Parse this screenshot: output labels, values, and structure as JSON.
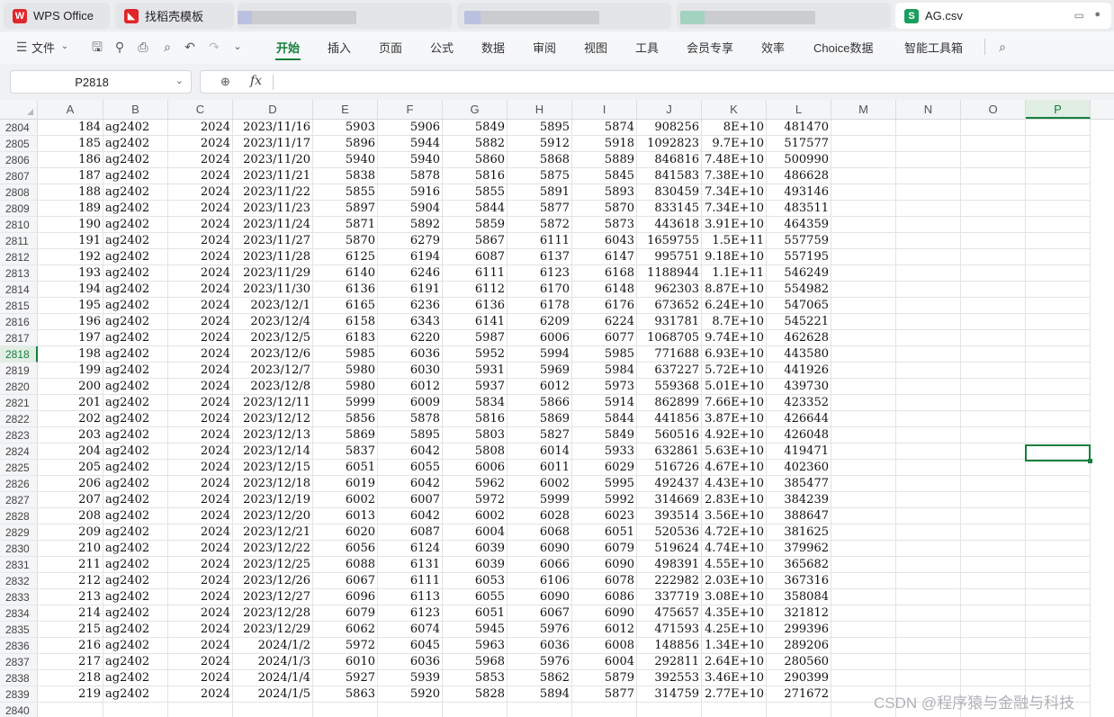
{
  "tabs": [
    {
      "label": "WPS Office",
      "icon": "wps-logo-icon",
      "color": "#e0262b"
    },
    {
      "label": "找稻壳模板",
      "icon": "docer-icon",
      "color": "#e0262b"
    },
    {
      "label": "",
      "icon": "blurred-tab",
      "color": "#9aa3d9"
    },
    {
      "label": "",
      "icon": "blurred-tab",
      "color": "#9aa3d9"
    },
    {
      "label": "",
      "icon": "blurred-tab",
      "color": "#6cc2a0"
    },
    {
      "label": "AG.csv",
      "icon": "spreadsheet-icon",
      "color": "#1a9e5c"
    }
  ],
  "ribbon": {
    "file_label": "文件",
    "tabs": [
      "开始",
      "插入",
      "页面",
      "公式",
      "数据",
      "审阅",
      "视图",
      "工具",
      "会员专享",
      "效率",
      "Choice数据",
      "智能工具箱"
    ],
    "active_tab": "开始"
  },
  "formula_bar": {
    "cell_ref": "P2818",
    "fx_label": "fx",
    "content": ""
  },
  "columns": [
    "A",
    "B",
    "C",
    "D",
    "E",
    "F",
    "G",
    "H",
    "I",
    "J",
    "K",
    "L",
    "M",
    "N",
    "O",
    "P"
  ],
  "selected_column": "P",
  "selected_row": "2818",
  "rows": [
    {
      "n": "2804",
      "v": [
        "184",
        "ag2402",
        "2024",
        "2023/11/16",
        "5903",
        "5906",
        "5849",
        "5895",
        "5874",
        "908256",
        "8E+10",
        "481470"
      ]
    },
    {
      "n": "2805",
      "v": [
        "185",
        "ag2402",
        "2024",
        "2023/11/17",
        "5896",
        "5944",
        "5882",
        "5912",
        "5918",
        "1092823",
        "9.7E+10",
        "517577"
      ]
    },
    {
      "n": "2806",
      "v": [
        "186",
        "ag2402",
        "2024",
        "2023/11/20",
        "5940",
        "5940",
        "5860",
        "5868",
        "5889",
        "846816",
        "7.48E+10",
        "500990"
      ]
    },
    {
      "n": "2807",
      "v": [
        "187",
        "ag2402",
        "2024",
        "2023/11/21",
        "5838",
        "5878",
        "5816",
        "5875",
        "5845",
        "841583",
        "7.38E+10",
        "486628"
      ]
    },
    {
      "n": "2808",
      "v": [
        "188",
        "ag2402",
        "2024",
        "2023/11/22",
        "5855",
        "5916",
        "5855",
        "5891",
        "5893",
        "830459",
        "7.34E+10",
        "493146"
      ]
    },
    {
      "n": "2809",
      "v": [
        "189",
        "ag2402",
        "2024",
        "2023/11/23",
        "5897",
        "5904",
        "5844",
        "5877",
        "5870",
        "833145",
        "7.34E+10",
        "483511"
      ]
    },
    {
      "n": "2810",
      "v": [
        "190",
        "ag2402",
        "2024",
        "2023/11/24",
        "5871",
        "5892",
        "5859",
        "5872",
        "5873",
        "443618",
        "3.91E+10",
        "464359"
      ]
    },
    {
      "n": "2811",
      "v": [
        "191",
        "ag2402",
        "2024",
        "2023/11/27",
        "5870",
        "6279",
        "5867",
        "6111",
        "6043",
        "1659755",
        "1.5E+11",
        "557759"
      ]
    },
    {
      "n": "2812",
      "v": [
        "192",
        "ag2402",
        "2024",
        "2023/11/28",
        "6125",
        "6194",
        "6087",
        "6137",
        "6147",
        "995751",
        "9.18E+10",
        "557195"
      ]
    },
    {
      "n": "2813",
      "v": [
        "193",
        "ag2402",
        "2024",
        "2023/11/29",
        "6140",
        "6246",
        "6111",
        "6123",
        "6168",
        "1188944",
        "1.1E+11",
        "546249"
      ]
    },
    {
      "n": "2814",
      "v": [
        "194",
        "ag2402",
        "2024",
        "2023/11/30",
        "6136",
        "6191",
        "6112",
        "6170",
        "6148",
        "962303",
        "8.87E+10",
        "554982"
      ]
    },
    {
      "n": "2815",
      "v": [
        "195",
        "ag2402",
        "2024",
        "2023/12/1",
        "6165",
        "6236",
        "6136",
        "6178",
        "6176",
        "673652",
        "6.24E+10",
        "547065"
      ]
    },
    {
      "n": "2816",
      "v": [
        "196",
        "ag2402",
        "2024",
        "2023/12/4",
        "6158",
        "6343",
        "6141",
        "6209",
        "6224",
        "931781",
        "8.7E+10",
        "545221"
      ]
    },
    {
      "n": "2817",
      "v": [
        "197",
        "ag2402",
        "2024",
        "2023/12/5",
        "6183",
        "6220",
        "5987",
        "6006",
        "6077",
        "1068705",
        "9.74E+10",
        "462628"
      ]
    },
    {
      "n": "2818",
      "v": [
        "198",
        "ag2402",
        "2024",
        "2023/12/6",
        "5985",
        "6036",
        "5952",
        "5994",
        "5985",
        "771688",
        "6.93E+10",
        "443580"
      ]
    },
    {
      "n": "2819",
      "v": [
        "199",
        "ag2402",
        "2024",
        "2023/12/7",
        "5980",
        "6030",
        "5931",
        "5969",
        "5984",
        "637227",
        "5.72E+10",
        "441926"
      ]
    },
    {
      "n": "2820",
      "v": [
        "200",
        "ag2402",
        "2024",
        "2023/12/8",
        "5980",
        "6012",
        "5937",
        "6012",
        "5973",
        "559368",
        "5.01E+10",
        "439730"
      ]
    },
    {
      "n": "2821",
      "v": [
        "201",
        "ag2402",
        "2024",
        "2023/12/11",
        "5999",
        "6009",
        "5834",
        "5866",
        "5914",
        "862899",
        "7.66E+10",
        "423352"
      ]
    },
    {
      "n": "2822",
      "v": [
        "202",
        "ag2402",
        "2024",
        "2023/12/12",
        "5856",
        "5878",
        "5816",
        "5869",
        "5844",
        "441856",
        "3.87E+10",
        "426644"
      ]
    },
    {
      "n": "2823",
      "v": [
        "203",
        "ag2402",
        "2024",
        "2023/12/13",
        "5869",
        "5895",
        "5803",
        "5827",
        "5849",
        "560516",
        "4.92E+10",
        "426048"
      ]
    },
    {
      "n": "2824",
      "v": [
        "204",
        "ag2402",
        "2024",
        "2023/12/14",
        "5837",
        "6042",
        "5808",
        "6014",
        "5933",
        "632861",
        "5.63E+10",
        "419471"
      ]
    },
    {
      "n": "2825",
      "v": [
        "205",
        "ag2402",
        "2024",
        "2023/12/15",
        "6051",
        "6055",
        "6006",
        "6011",
        "6029",
        "516726",
        "4.67E+10",
        "402360"
      ]
    },
    {
      "n": "2826",
      "v": [
        "206",
        "ag2402",
        "2024",
        "2023/12/18",
        "6019",
        "6042",
        "5962",
        "6002",
        "5995",
        "492437",
        "4.43E+10",
        "385477"
      ]
    },
    {
      "n": "2827",
      "v": [
        "207",
        "ag2402",
        "2024",
        "2023/12/19",
        "6002",
        "6007",
        "5972",
        "5999",
        "5992",
        "314669",
        "2.83E+10",
        "384239"
      ]
    },
    {
      "n": "2828",
      "v": [
        "208",
        "ag2402",
        "2024",
        "2023/12/20",
        "6013",
        "6042",
        "6002",
        "6028",
        "6023",
        "393514",
        "3.56E+10",
        "388647"
      ]
    },
    {
      "n": "2829",
      "v": [
        "209",
        "ag2402",
        "2024",
        "2023/12/21",
        "6020",
        "6087",
        "6004",
        "6068",
        "6051",
        "520536",
        "4.72E+10",
        "381625"
      ]
    },
    {
      "n": "2830",
      "v": [
        "210",
        "ag2402",
        "2024",
        "2023/12/22",
        "6056",
        "6124",
        "6039",
        "6090",
        "6079",
        "519624",
        "4.74E+10",
        "379962"
      ]
    },
    {
      "n": "2831",
      "v": [
        "211",
        "ag2402",
        "2024",
        "2023/12/25",
        "6088",
        "6131",
        "6039",
        "6066",
        "6090",
        "498391",
        "4.55E+10",
        "365682"
      ]
    },
    {
      "n": "2832",
      "v": [
        "212",
        "ag2402",
        "2024",
        "2023/12/26",
        "6067",
        "6111",
        "6053",
        "6106",
        "6078",
        "222982",
        "2.03E+10",
        "367316"
      ]
    },
    {
      "n": "2833",
      "v": [
        "213",
        "ag2402",
        "2024",
        "2023/12/27",
        "6096",
        "6113",
        "6055",
        "6090",
        "6086",
        "337719",
        "3.08E+10",
        "358084"
      ]
    },
    {
      "n": "2834",
      "v": [
        "214",
        "ag2402",
        "2024",
        "2023/12/28",
        "6079",
        "6123",
        "6051",
        "6067",
        "6090",
        "475657",
        "4.35E+10",
        "321812"
      ]
    },
    {
      "n": "2835",
      "v": [
        "215",
        "ag2402",
        "2024",
        "2023/12/29",
        "6062",
        "6074",
        "5945",
        "5976",
        "6012",
        "471593",
        "4.25E+10",
        "299396"
      ]
    },
    {
      "n": "2836",
      "v": [
        "216",
        "ag2402",
        "2024",
        "2024/1/2",
        "5972",
        "6045",
        "5963",
        "6036",
        "6008",
        "148856",
        "1.34E+10",
        "289206"
      ]
    },
    {
      "n": "2837",
      "v": [
        "217",
        "ag2402",
        "2024",
        "2024/1/3",
        "6010",
        "6036",
        "5968",
        "5976",
        "6004",
        "292811",
        "2.64E+10",
        "280560"
      ]
    },
    {
      "n": "2838",
      "v": [
        "218",
        "ag2402",
        "2024",
        "2024/1/4",
        "5927",
        "5939",
        "5853",
        "5862",
        "5879",
        "392553",
        "3.46E+10",
        "290399"
      ]
    },
    {
      "n": "2839",
      "v": [
        "219",
        "ag2402",
        "2024",
        "2024/1/5",
        "5863",
        "5920",
        "5828",
        "5894",
        "5877",
        "314759",
        "2.77E+10",
        "271672"
      ]
    },
    {
      "n": "2840",
      "v": [
        "",
        "",
        "",
        "",
        "",
        "",
        "",
        "",
        "",
        "",
        "",
        ""
      ]
    }
  ],
  "watermark": "CSDN @程序猿与金融与科技"
}
